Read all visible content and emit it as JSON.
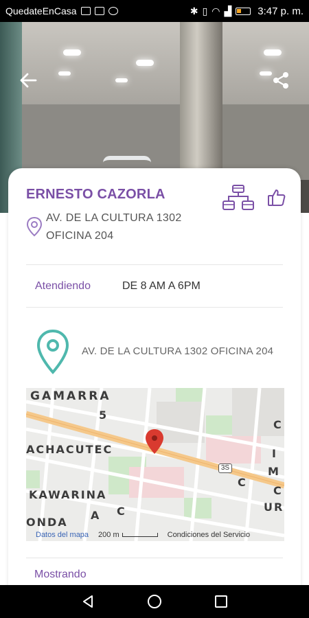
{
  "status_bar": {
    "carrier": "QuedateEnCasa",
    "time": "3:47 p. m."
  },
  "header": {
    "back_icon": "arrow-left-icon",
    "share_icon": "share-icon"
  },
  "profile": {
    "name": "ERNESTO CAZORLA",
    "address_line1": "AV. DE LA CULTURA 1302",
    "address_line2": "OFICINA 204",
    "network_icon": "network-icon",
    "like_icon": "thumbs-up-icon"
  },
  "hours": {
    "label": "Atendiendo",
    "value": "DE 8 AM A 6PM"
  },
  "location": {
    "address": "AV. DE LA CULTURA 1302 OFICINA 204"
  },
  "map": {
    "labels": [
      "GAMARRA",
      "ACHACUTEC",
      "KAWARINA",
      "ONDA",
      "5",
      "C",
      "A",
      "C",
      "C",
      "I",
      "M",
      "UR",
      "C"
    ],
    "route_shield": "3S",
    "footer": {
      "data_link": "Datos del mapa",
      "scale": "200 m",
      "terms": "Condiciones del Servicio"
    }
  },
  "section": {
    "showing_label": "Mostrando"
  },
  "colors": {
    "accent": "#7a4fa6",
    "pin_teal": "#4fb8ad",
    "map_pin": "#d93a2f"
  }
}
